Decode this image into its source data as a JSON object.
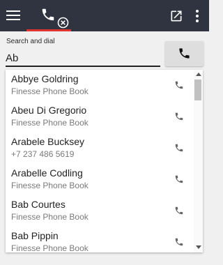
{
  "topbar": {
    "menu_icon": "hamburger-icon",
    "tab_icon": "phone-icon",
    "tab_badge_icon": "close-circle-icon",
    "popout_icon": "open-in-new-icon",
    "more_icon": "more-vertical-icon",
    "accent_color": "#e0342f",
    "background": "#2f3440"
  },
  "search": {
    "label": "Search and dial",
    "value": "Ab"
  },
  "dial_button": {
    "icon": "phone-icon"
  },
  "results": [
    {
      "name": "Abbye Goldring",
      "detail": "Finesse Phone Book"
    },
    {
      "name": "Abeu Di Gregorio",
      "detail": "Finesse Phone Book"
    },
    {
      "name": "Arabele Bucksey",
      "detail": "+7 237 486 5619"
    },
    {
      "name": "Arabelle Codling",
      "detail": "Finesse Phone Book"
    },
    {
      "name": "Bab Courtes",
      "detail": "Finesse Phone Book"
    },
    {
      "name": "Bab Pippin",
      "detail": "Finesse Phone Book"
    }
  ]
}
